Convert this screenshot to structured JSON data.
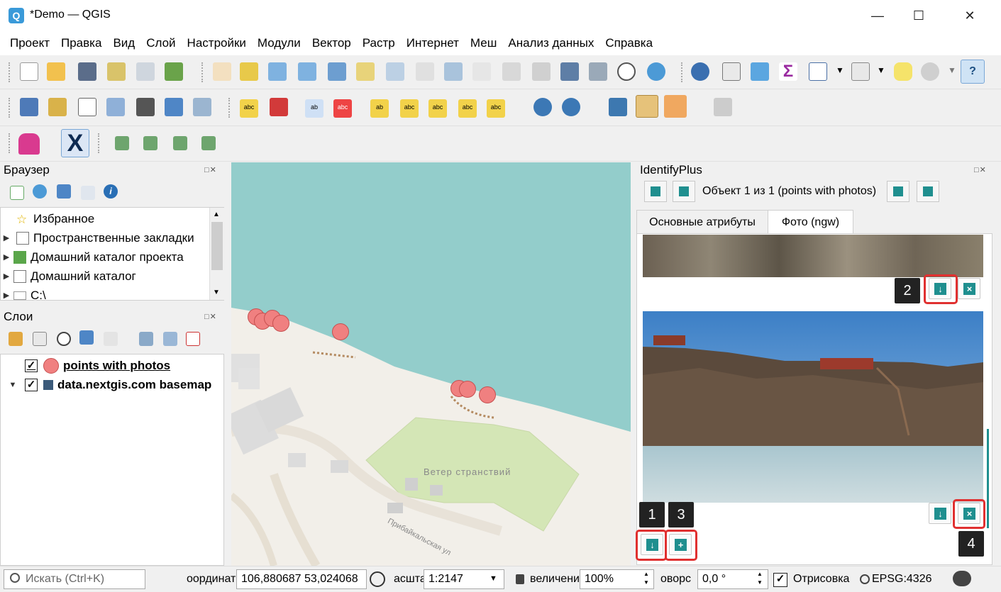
{
  "window": {
    "title": "*Demo — QGIS",
    "logo": "Q"
  },
  "menu": [
    "Проект",
    "Правка",
    "Вид",
    "Слой",
    "Настройки",
    "Модули",
    "Вектор",
    "Растр",
    "Интернет",
    "Меш",
    "Анализ данных",
    "Справка"
  ],
  "browser": {
    "title": "Браузер",
    "items": [
      {
        "label": "Избранное",
        "icon": "star-icon"
      },
      {
        "label": "Пространственные закладки",
        "icon": "bookmark-icon"
      },
      {
        "label": "Домашний каталог проекта",
        "icon": "project-home-icon"
      },
      {
        "label": "Домашний каталог",
        "icon": "home-folder-icon"
      },
      {
        "label": "C:\\",
        "icon": "drive-icon"
      }
    ]
  },
  "layers": {
    "title": "Слои",
    "items": [
      {
        "label": "points with photos",
        "checked": "✓",
        "icon": "point-layer-icon"
      },
      {
        "label": "data.nextgis.com basemap",
        "checked": "✓",
        "icon": "raster-layer-icon"
      }
    ]
  },
  "map": {
    "label": "Ветер странствий",
    "street_label": "Прибайкальская ул"
  },
  "identify": {
    "title": "IdentifyPlus",
    "object_text": "Объект 1 из 1 (points with photos)",
    "tabs": [
      "Основные атрибуты",
      "Фото (ngw)"
    ],
    "markers": [
      "1",
      "2",
      "3",
      "4"
    ]
  },
  "status": {
    "search_placeholder": "Искать (Ctrl+K)",
    "coord_label": "оординат",
    "coord_value": "106,880687 53,024068",
    "scale_label": "асшта",
    "scale_value": "1:2147",
    "magnify_label": "величени",
    "magnify_value": "100%",
    "rotation_label": "оворс",
    "rotation_value": "0,0 °",
    "render_label": "Отрисовка",
    "crs": "EPSG:4326"
  },
  "colors": {
    "accent": "#1f8f8f",
    "water": "#93cdcb",
    "point": "#f08080",
    "highlight": "#e03030"
  }
}
